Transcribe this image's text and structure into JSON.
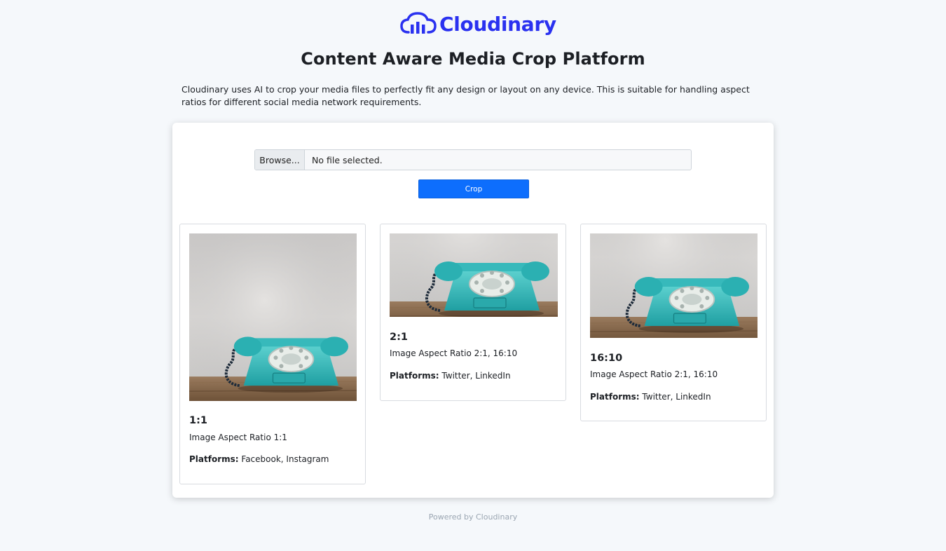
{
  "brand": {
    "name": "Cloudinary",
    "color": "#2a31f0"
  },
  "header": {
    "title": "Content Aware Media Crop Platform",
    "description": "Cloudinary uses AI to crop your media files to perfectly fit any design or layout on any device. This is suitable for handling aspect ratios for different social media network requirements."
  },
  "upload": {
    "browse_label": "Browse...",
    "file_status": "No file selected.",
    "crop_label": "Crop",
    "accent": "#0d6efd"
  },
  "cards": [
    {
      "title": "1:1",
      "ratio_text": "Image Aspect Ratio 1:1",
      "platforms_label": "Platforms:",
      "platforms": "Facebook, Instagram",
      "image": "rotary-telephone-photo"
    },
    {
      "title": "2:1",
      "ratio_text": "Image Aspect Ratio 2:1, 16:10",
      "platforms_label": "Platforms:",
      "platforms": "Twitter, LinkedIn",
      "image": "rotary-telephone-photo"
    },
    {
      "title": "16:10",
      "ratio_text": "Image Aspect Ratio 2:1, 16:10",
      "platforms_label": "Platforms:",
      "platforms": "Twitter, LinkedIn",
      "image": "rotary-telephone-photo"
    }
  ],
  "footer": {
    "text": "Powered by Cloudinary"
  }
}
